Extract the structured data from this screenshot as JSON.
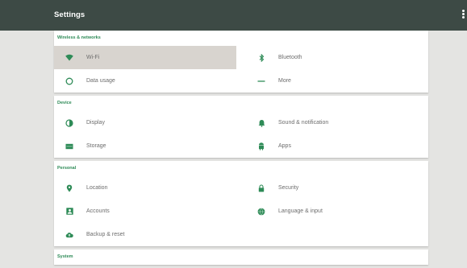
{
  "appbar": {
    "title": "Settings"
  },
  "colors": {
    "appbar": "#3d4a45",
    "accent": "#2e8b57",
    "selected_bg": "#d8d4cf",
    "background": "#e4e4e2"
  },
  "sections": [
    {
      "title": "Wireless & networks",
      "items": [
        {
          "label": "Wi-Fi",
          "icon": "wifi-icon",
          "selected": true
        },
        {
          "label": "Bluetooth",
          "icon": "bluetooth-icon"
        },
        {
          "label": "Data usage",
          "icon": "data-usage-icon"
        },
        {
          "label": "More",
          "icon": "more-icon"
        }
      ]
    },
    {
      "title": "Device",
      "items": [
        {
          "label": "Display",
          "icon": "display-icon"
        },
        {
          "label": "Sound & notification",
          "icon": "bell-icon"
        },
        {
          "label": "Storage",
          "icon": "storage-icon"
        },
        {
          "label": "Apps",
          "icon": "android-icon"
        }
      ]
    },
    {
      "title": "Personal",
      "items": [
        {
          "label": "Location",
          "icon": "location-pin-icon"
        },
        {
          "label": "Security",
          "icon": "lock-icon"
        },
        {
          "label": "Accounts",
          "icon": "account-icon"
        },
        {
          "label": "Language & input",
          "icon": "globe-icon"
        },
        {
          "label": "Backup & reset",
          "icon": "cloud-icon"
        }
      ]
    },
    {
      "title": "System",
      "items": []
    }
  ]
}
